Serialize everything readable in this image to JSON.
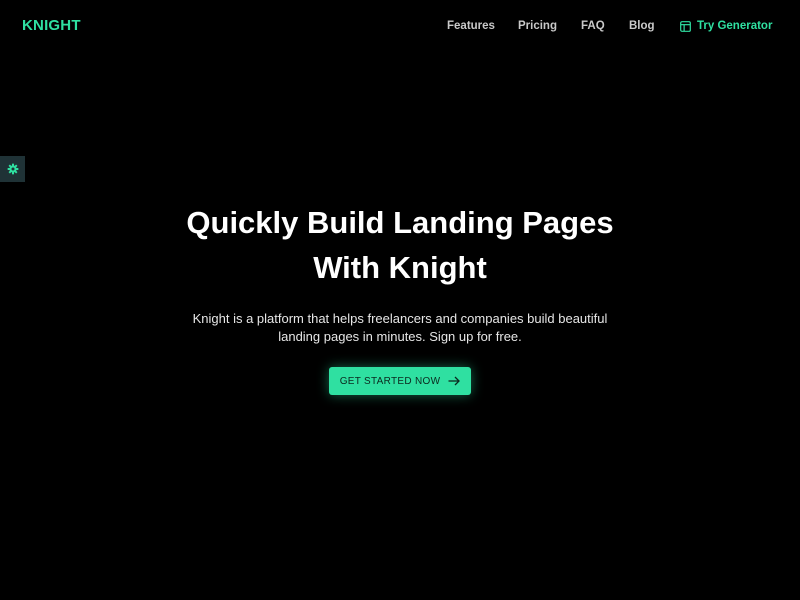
{
  "brand": {
    "name": "KNIGHT",
    "accent_color": "#2fe0a1"
  },
  "nav": {
    "items": [
      {
        "label": "Features"
      },
      {
        "label": "Pricing"
      },
      {
        "label": "FAQ"
      },
      {
        "label": "Blog"
      }
    ],
    "generator": {
      "label": "Try Generator",
      "icon": "layout-icon"
    }
  },
  "settings_tab": {
    "icon": "gear-icon"
  },
  "hero": {
    "title_line1": "Quickly Build Landing Pages",
    "title_line2": "With Knight",
    "description_line1": "Knight is a platform that helps freelancers and companies build beautiful",
    "description_line2": "landing pages in minutes. Sign up for free.",
    "cta": {
      "label": "GET STARTED NOW",
      "icon": "arrow-right-icon"
    }
  }
}
